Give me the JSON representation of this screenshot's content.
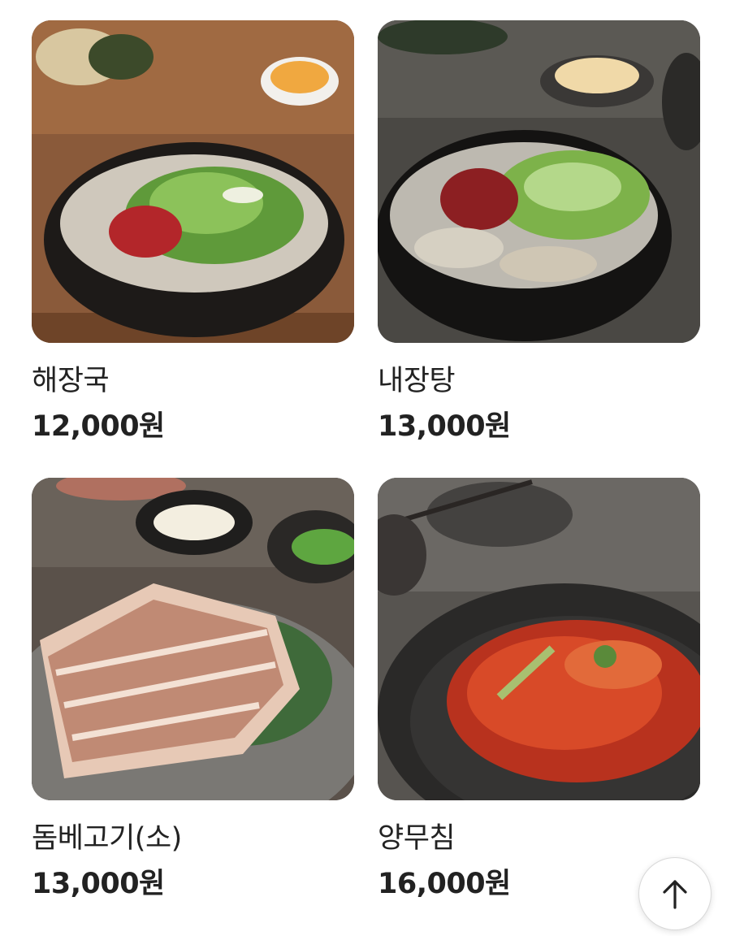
{
  "menu": {
    "items": [
      {
        "name": "해장국",
        "price": "12,000원",
        "photo": "hangover-soup-photo"
      },
      {
        "name": "내장탕",
        "price": "13,000원",
        "photo": "tripe-soup-photo"
      },
      {
        "name": "돔베고기(소)",
        "price": "13,000원",
        "photo": "boiled-pork-photo"
      },
      {
        "name": "양무침",
        "price": "16,000원",
        "photo": "spicy-tripe-salad-photo"
      }
    ]
  },
  "scroll_top_button": {
    "icon": "arrow-up-icon"
  },
  "colors": {
    "text": "#222222",
    "background": "#ffffff"
  }
}
